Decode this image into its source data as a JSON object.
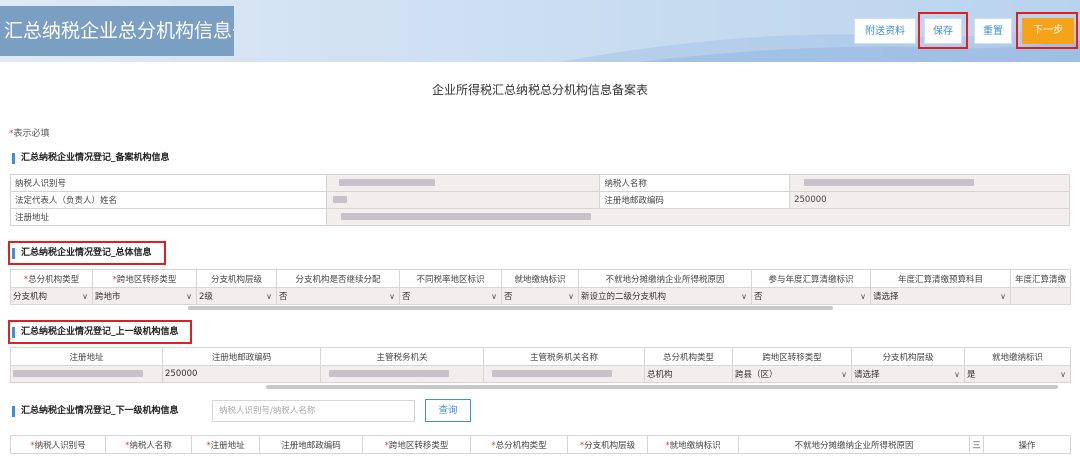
{
  "header": {
    "title": "汇总纳税企业总分机构信息备案",
    "buttons": {
      "attach": "附送资料",
      "save": "保存",
      "reset": "重置",
      "next": "下一步"
    }
  },
  "page_title": "企业所得税汇总纳税总分机构信息备案表",
  "required_note": {
    "star": "*",
    "text": "表示必填"
  },
  "sections": {
    "filing": "汇总纳税企业情况登记_备案机构信息",
    "overall": "汇总纳税企业情况登记_总体信息",
    "upper": "汇总纳税企业情况登记_上一级机构信息",
    "lower": "汇总纳税企业情况登记_下一级机构信息"
  },
  "filing_info": {
    "taxpayer_id_label": "纳税人识别号",
    "taxpayer_name_label": "纳税人名称",
    "legal_rep_label": "法定代表人（负责人）姓名",
    "postcode_label": "注册地邮政编码",
    "postcode_value": "250000",
    "address_label": "注册地址"
  },
  "overall_table": {
    "headers": [
      {
        "star": "*",
        "text": "总分机构类型"
      },
      {
        "star": "*",
        "text": "跨地区转移类型"
      },
      {
        "star": "",
        "text": "分支机构层级"
      },
      {
        "star": "",
        "text": "分支机构是否继续分配"
      },
      {
        "star": "",
        "text": "不同税率地区标识"
      },
      {
        "star": "",
        "text": "就地缴纳标识"
      },
      {
        "star": "",
        "text": "不就地分摊缴纳企业所得税原因"
      },
      {
        "star": "",
        "text": "参与年度汇算清缴标识"
      },
      {
        "star": "",
        "text": "年度汇算清缴预算科目"
      },
      {
        "star": "",
        "text": "年度汇算清缴"
      }
    ],
    "row": [
      "分支机构",
      "跨地市",
      "2级",
      "否",
      "否",
      "否",
      "新设立的二级分支机构",
      "否",
      "请选择",
      ""
    ]
  },
  "upper_table": {
    "headers": [
      "注册地址",
      "注册地邮政编码",
      "主管税务机关",
      "主管税务机关名称",
      "总分机构类型",
      "跨地区转移类型",
      "分支机构层级",
      "就地缴纳标识"
    ],
    "row": [
      "",
      "250000",
      "",
      "",
      "总机构",
      "跨县（区）",
      "请选择",
      "是"
    ]
  },
  "lower_search": {
    "placeholder": "纳税人识别号/纳税人名称",
    "button": "查询"
  },
  "lower_table": {
    "headers": [
      {
        "star": "*",
        "text": "纳税人识别号"
      },
      {
        "star": "*",
        "text": "纳税人名称"
      },
      {
        "star": "*",
        "text": "注册地址"
      },
      {
        "star": "",
        "text": "注册地邮政编码"
      },
      {
        "star": "*",
        "text": "跨地区转移类型"
      },
      {
        "star": "*",
        "text": "总分机构类型"
      },
      {
        "star": "*",
        "text": "分支机构层级"
      },
      {
        "star": "*",
        "text": "就地缴纳标识"
      },
      {
        "star": "",
        "text": "不就地分摊缴纳企业所得税原因"
      },
      {
        "star": "",
        "text": "三"
      },
      {
        "star": "",
        "text": "操作"
      }
    ]
  },
  "colors": {
    "accent": "#3d8fd6",
    "primary_button": "#f6a31a",
    "highlight_border": "#e02020",
    "title_bg": "#7a9fc2"
  }
}
